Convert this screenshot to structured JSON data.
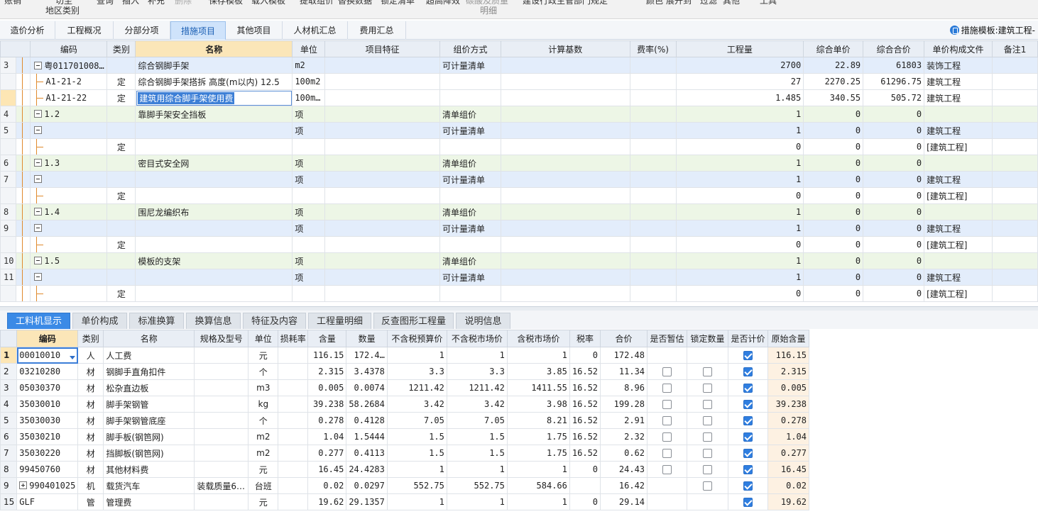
{
  "ribbon": {
    "top_items": [
      "账销",
      "切至",
      "查询",
      "插入",
      "补充",
      "删除",
      "保存模板",
      "载入模板",
      "提取组价",
      "替换数据",
      "锁定清单",
      "超高降效",
      "碳酸及质量",
      "建设行政主管部门规定",
      "颜色",
      "展开到",
      "过滤",
      "其他",
      "工具"
    ],
    "second_items": [
      "地区类别",
      "明细"
    ]
  },
  "tabs": [
    "造价分析",
    "工程概况",
    "分部分项",
    "措施项目",
    "其他项目",
    "人材机汇总",
    "费用汇总"
  ],
  "active_tab": "措施项目",
  "template_label": "措施模板:建筑工程-",
  "upper_headers": [
    "编码",
    "类别",
    "名称",
    "单位",
    "项目特征",
    "组价方式",
    "计算基数",
    "费率(%)",
    "工程量",
    "综合单价",
    "综合合价",
    "单价构成文件",
    "备注1"
  ],
  "upper_rows": [
    {
      "num": "3",
      "code": "粤011701008…",
      "cat": "",
      "name": "综合钢脚手架",
      "unit": "m2",
      "feature": "",
      "method": "可计量清单",
      "base": "",
      "rate": "",
      "qty": "2700",
      "uprice": "22.89",
      "total": "61803",
      "file": "装饰工程"
    },
    {
      "num": "",
      "code": "A1-21-2",
      "cat": "定",
      "name": "综合钢脚手架搭拆 高度(m以内) 12.5",
      "unit": "100m2",
      "feature": "",
      "method": "",
      "base": "",
      "rate": "",
      "qty": "27",
      "uprice": "2270.25",
      "total": "61296.75",
      "file": "建筑工程"
    },
    {
      "num": "",
      "code": "A1-21-22",
      "cat": "定",
      "name": "建筑用综合脚手架使用费",
      "unit": "100m…",
      "feature": "",
      "method": "",
      "base": "",
      "rate": "",
      "qty": "1.485",
      "uprice": "340.55",
      "total": "505.72",
      "file": "建筑工程"
    },
    {
      "num": "4",
      "code": "1.2",
      "cat": "",
      "name": "靠脚手架安全挡板",
      "unit": "项",
      "feature": "",
      "method": "清单组价",
      "base": "",
      "rate": "",
      "qty": "1",
      "uprice": "0",
      "total": "0",
      "file": ""
    },
    {
      "num": "5",
      "code": "",
      "cat": "",
      "name": "",
      "unit": "项",
      "feature": "",
      "method": "可计量清单",
      "base": "",
      "rate": "",
      "qty": "1",
      "uprice": "0",
      "total": "0",
      "file": "建筑工程"
    },
    {
      "num": "",
      "code": "",
      "cat": "定",
      "name": "",
      "unit": "",
      "feature": "",
      "method": "",
      "base": "",
      "rate": "",
      "qty": "0",
      "uprice": "0",
      "total": "0",
      "file": "[建筑工程]"
    },
    {
      "num": "6",
      "code": "1.3",
      "cat": "",
      "name": "密目式安全网",
      "unit": "项",
      "feature": "",
      "method": "清单组价",
      "base": "",
      "rate": "",
      "qty": "1",
      "uprice": "0",
      "total": "0",
      "file": ""
    },
    {
      "num": "7",
      "code": "",
      "cat": "",
      "name": "",
      "unit": "项",
      "feature": "",
      "method": "可计量清单",
      "base": "",
      "rate": "",
      "qty": "1",
      "uprice": "0",
      "total": "0",
      "file": "建筑工程"
    },
    {
      "num": "",
      "code": "",
      "cat": "定",
      "name": "",
      "unit": "",
      "feature": "",
      "method": "",
      "base": "",
      "rate": "",
      "qty": "0",
      "uprice": "0",
      "total": "0",
      "file": "[建筑工程]"
    },
    {
      "num": "8",
      "code": "1.4",
      "cat": "",
      "name": "围尼龙编织布",
      "unit": "项",
      "feature": "",
      "method": "清单组价",
      "base": "",
      "rate": "",
      "qty": "1",
      "uprice": "0",
      "total": "0",
      "file": ""
    },
    {
      "num": "9",
      "code": "",
      "cat": "",
      "name": "",
      "unit": "项",
      "feature": "",
      "method": "可计量清单",
      "base": "",
      "rate": "",
      "qty": "1",
      "uprice": "0",
      "total": "0",
      "file": "建筑工程"
    },
    {
      "num": "",
      "code": "",
      "cat": "定",
      "name": "",
      "unit": "",
      "feature": "",
      "method": "",
      "base": "",
      "rate": "",
      "qty": "0",
      "uprice": "0",
      "total": "0",
      "file": "[建筑工程]"
    },
    {
      "num": "10",
      "code": "1.5",
      "cat": "",
      "name": "模板的支架",
      "unit": "项",
      "feature": "",
      "method": "清单组价",
      "base": "",
      "rate": "",
      "qty": "1",
      "uprice": "0",
      "total": "0",
      "file": ""
    },
    {
      "num": "11",
      "code": "",
      "cat": "",
      "name": "",
      "unit": "项",
      "feature": "",
      "method": "可计量清单",
      "base": "",
      "rate": "",
      "qty": "1",
      "uprice": "0",
      "total": "0",
      "file": "建筑工程"
    },
    {
      "num": "",
      "code": "",
      "cat": "定",
      "name": "",
      "unit": "",
      "feature": "",
      "method": "",
      "base": "",
      "rate": "",
      "qty": "0",
      "uprice": "0",
      "total": "0",
      "file": "[建筑工程]"
    }
  ],
  "bottom_tabs": [
    "工料机显示",
    "单价构成",
    "标准换算",
    "换算信息",
    "特征及内容",
    "工程量明细",
    "反查图形工程量",
    "说明信息"
  ],
  "active_bottom_tab": "工料机显示",
  "lower_headers": [
    "编码",
    "类别",
    "名称",
    "规格及型号",
    "单位",
    "损耗率",
    "含量",
    "数量",
    "不含税预算价",
    "不含税市场价",
    "含税市场价",
    "税率",
    "合价",
    "是否暂估",
    "锁定数量",
    "是否计价",
    "原始含量"
  ],
  "lower_rows": [
    {
      "num": "1",
      "code": "00010010",
      "cat": "人",
      "name": "人工费",
      "spec": "",
      "unit": "元",
      "loss": "",
      "content": "116.15",
      "qty": "172.4…",
      "budget": "1",
      "market": "1",
      "taxmarket": "1",
      "tax": "0",
      "total": "172.48",
      "est": "",
      "lock": "",
      "price": true,
      "orig": "116.15"
    },
    {
      "num": "2",
      "code": "03210280",
      "cat": "材",
      "name": "钢脚手直角扣件",
      "spec": "",
      "unit": "个",
      "loss": "",
      "content": "2.315",
      "qty": "3.4378",
      "budget": "3.3",
      "market": "3.3",
      "taxmarket": "3.85",
      "tax": "16.52",
      "total": "11.34",
      "est": "cb",
      "lock": "cb",
      "price": true,
      "orig": "2.315"
    },
    {
      "num": "3",
      "code": "05030370",
      "cat": "材",
      "name": "松杂直边板",
      "spec": "",
      "unit": "m3",
      "loss": "",
      "content": "0.005",
      "qty": "0.0074",
      "budget": "1211.42",
      "market": "1211.42",
      "taxmarket": "1411.55",
      "tax": "16.52",
      "total": "8.96",
      "est": "cb",
      "lock": "cb",
      "price": true,
      "orig": "0.005"
    },
    {
      "num": "4",
      "code": "35030010",
      "cat": "材",
      "name": "脚手架钢管",
      "spec": "",
      "unit": "kg",
      "loss": "",
      "content": "39.238",
      "qty": "58.2684",
      "budget": "3.42",
      "market": "3.42",
      "taxmarket": "3.98",
      "tax": "16.52",
      "total": "199.28",
      "est": "cb",
      "lock": "cb",
      "price": true,
      "orig": "39.238"
    },
    {
      "num": "5",
      "code": "35030030",
      "cat": "材",
      "name": "脚手架钢管底座",
      "spec": "",
      "unit": "个",
      "loss": "",
      "content": "0.278",
      "qty": "0.4128",
      "budget": "7.05",
      "market": "7.05",
      "taxmarket": "8.21",
      "tax": "16.52",
      "total": "2.91",
      "est": "cb",
      "lock": "cb",
      "price": true,
      "orig": "0.278"
    },
    {
      "num": "6",
      "code": "35030210",
      "cat": "材",
      "name": "脚手板(钢笆网)",
      "spec": "",
      "unit": "m2",
      "loss": "",
      "content": "1.04",
      "qty": "1.5444",
      "budget": "1.5",
      "market": "1.5",
      "taxmarket": "1.75",
      "tax": "16.52",
      "total": "2.32",
      "est": "cb",
      "lock": "cb",
      "price": true,
      "orig": "1.04"
    },
    {
      "num": "7",
      "code": "35030220",
      "cat": "材",
      "name": "挡脚板(钢笆网)",
      "spec": "",
      "unit": "m2",
      "loss": "",
      "content": "0.277",
      "qty": "0.4113",
      "budget": "1.5",
      "market": "1.5",
      "taxmarket": "1.75",
      "tax": "16.52",
      "total": "0.62",
      "est": "cb",
      "lock": "cb",
      "price": true,
      "orig": "0.277"
    },
    {
      "num": "8",
      "code": "99450760",
      "cat": "材",
      "name": "其他材料费",
      "spec": "",
      "unit": "元",
      "loss": "",
      "content": "16.45",
      "qty": "24.4283",
      "budget": "1",
      "market": "1",
      "taxmarket": "1",
      "tax": "0",
      "total": "24.43",
      "est": "cb",
      "lock": "cb",
      "price": true,
      "orig": "16.45"
    },
    {
      "num": "9",
      "code": "990401025",
      "cat": "机",
      "name": "载货汽车",
      "spec": "装载质量6…",
      "unit": "台班",
      "loss": "",
      "content": "0.02",
      "qty": "0.0297",
      "budget": "552.75",
      "market": "552.75",
      "taxmarket": "584.66",
      "tax": "",
      "total": "16.42",
      "est": "",
      "lock": "cb",
      "price": true,
      "orig": "0.02"
    },
    {
      "num": "15",
      "code": "GLF",
      "cat": "管",
      "name": "管理费",
      "spec": "",
      "unit": "元",
      "loss": "",
      "content": "19.62",
      "qty": "29.1357",
      "budget": "1",
      "market": "1",
      "taxmarket": "1",
      "tax": "0",
      "total": "29.14",
      "est": "",
      "lock": "",
      "price": true,
      "orig": "19.62"
    }
  ]
}
